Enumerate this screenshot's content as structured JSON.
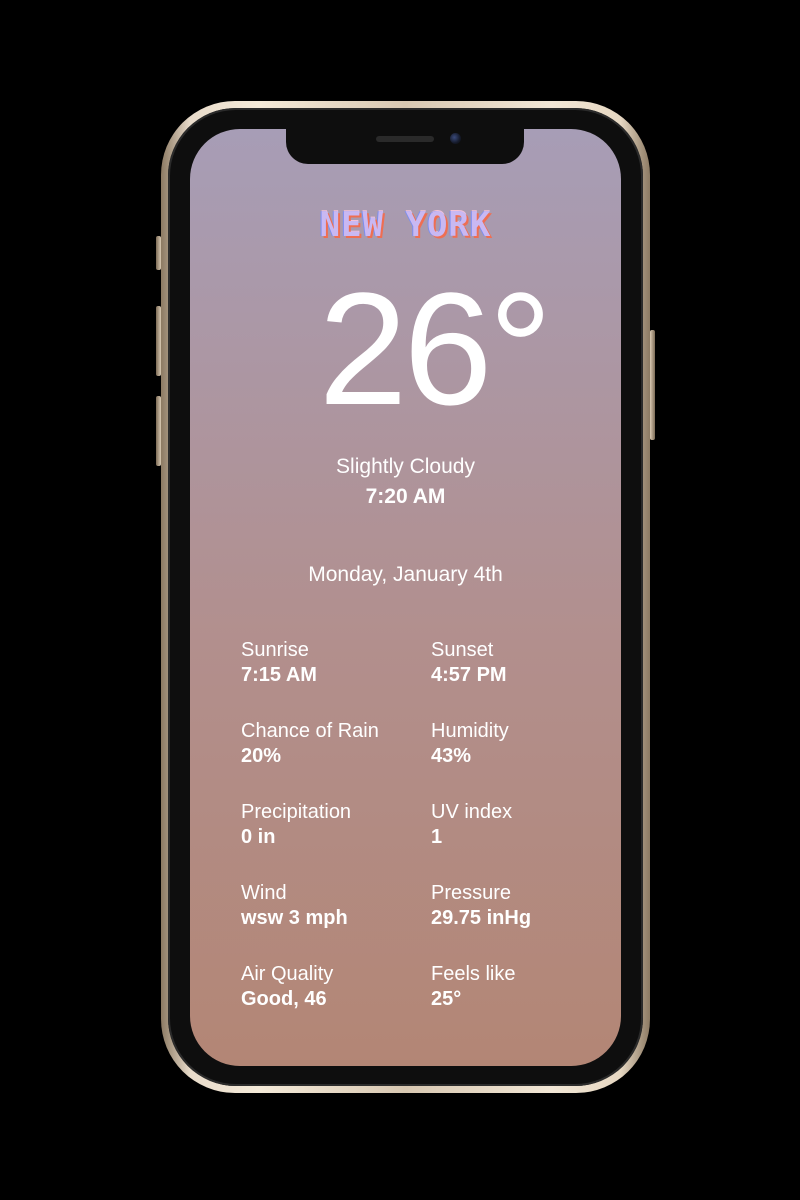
{
  "city": "NEW YORK",
  "temperature": "26°",
  "condition": "Slightly Cloudy",
  "time": "7:20 AM",
  "date": "Monday, January 4th",
  "stats": [
    {
      "label": "Sunrise",
      "value": "7:15 AM"
    },
    {
      "label": "Sunset",
      "value": "4:57 PM"
    },
    {
      "label": "Chance of Rain",
      "value": "20%"
    },
    {
      "label": "Humidity",
      "value": "43%"
    },
    {
      "label": "Precipitation",
      "value": "0 in"
    },
    {
      "label": "UV index",
      "value": "1"
    },
    {
      "label": "Wind",
      "value": "wsw 3 mph"
    },
    {
      "label": "Pressure",
      "value": "29.75 inHg"
    },
    {
      "label": "Air Quality",
      "value": "Good, 46"
    },
    {
      "label": "Feels like",
      "value": "25°"
    }
  ],
  "colors": {
    "background": "#000000",
    "gradient_top": "#a79db6",
    "gradient_bottom": "#b38675",
    "city_accent": "#ef6e52",
    "frame": "#e9dccb"
  }
}
